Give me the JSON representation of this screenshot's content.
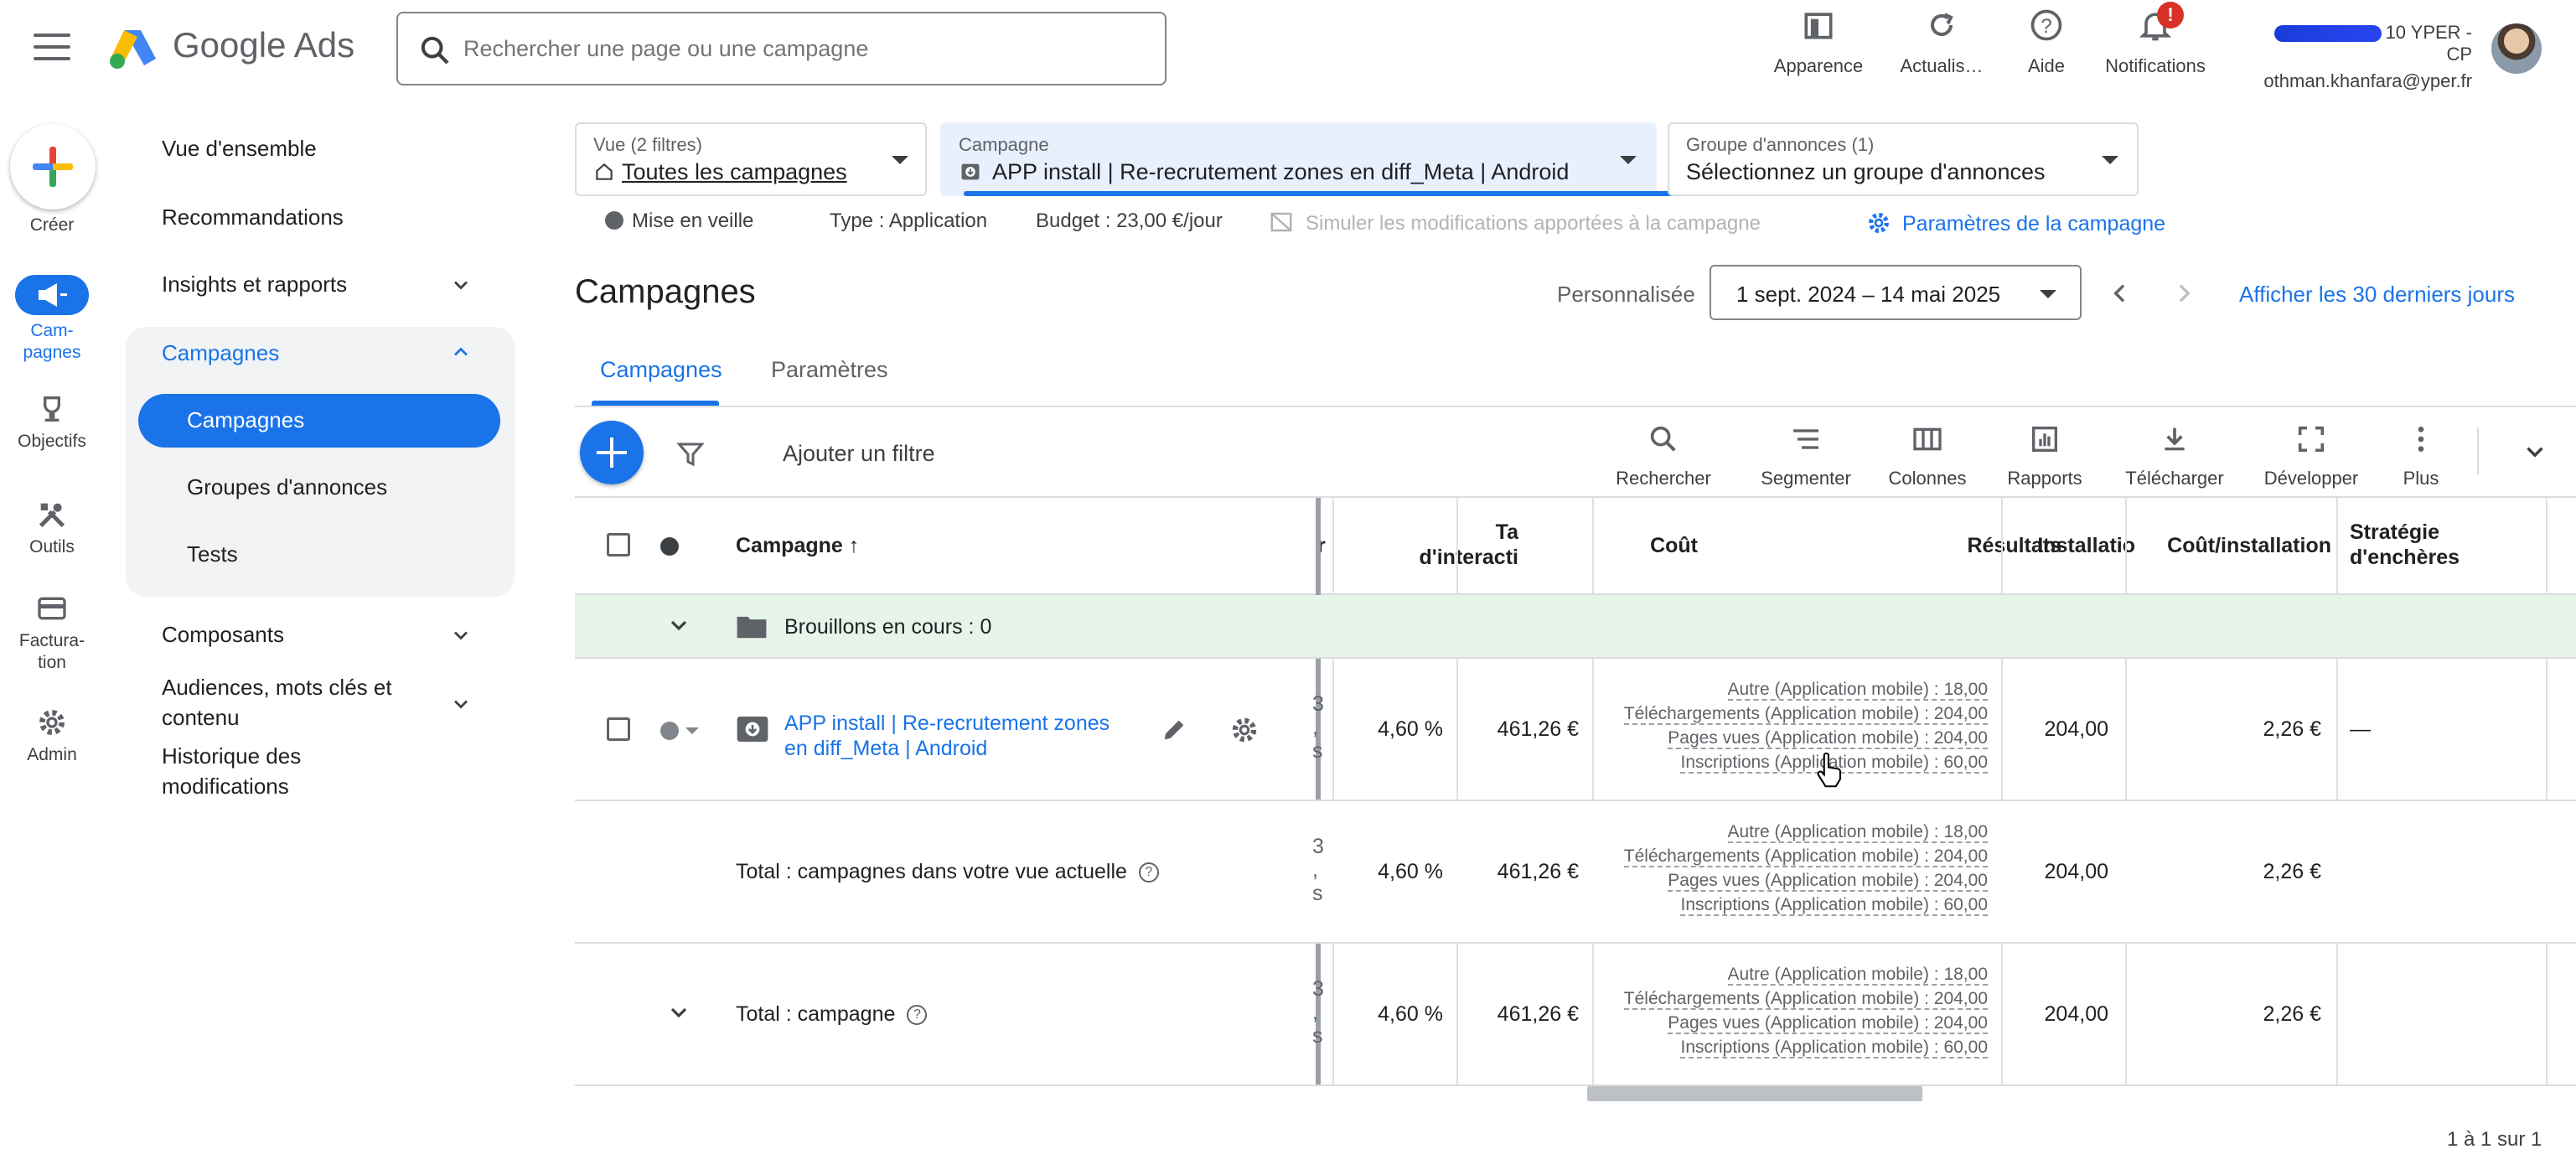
{
  "app": {
    "brand": "Google Ads"
  },
  "search": {
    "placeholder": "Rechercher une page ou une campagne"
  },
  "top_actions": {
    "appearance": "Apparence",
    "refresh": "Actualis…",
    "help": "Aide",
    "notifications": "Notifications",
    "notif_badge": "!"
  },
  "account": {
    "name": "10 YPER - CP",
    "email": "othman.khanfara@yper.fr"
  },
  "rail": {
    "create": "Créer",
    "campaigns": "Cam-\npagnes",
    "goals": "Objectifs",
    "tools": "Outils",
    "billing": "Factura-\ntion",
    "admin": "Admin"
  },
  "nav": {
    "overview": "Vue d'ensemble",
    "recommendations": "Recommandations",
    "insights": "Insights et rapports",
    "campaigns_group": "Campagnes",
    "campaigns": "Campagnes",
    "ad_groups": "Groupes d'annonces",
    "tests": "Tests",
    "assets": "Composants",
    "audiences": "Audiences, mots clés et contenu",
    "history": "Historique des modifications"
  },
  "filters": {
    "view_label": "Vue (2 filtres)",
    "view_value": "Toutes les campagnes",
    "campaign_label": "Campagne",
    "campaign_value": "APP install | Re-recrutement zones en diff_Meta | Android",
    "adgroup_label": "Groupe d'annonces (1)",
    "adgroup_value": "Sélectionnez un groupe d'annonces"
  },
  "campaign_info": {
    "status": "Mise en veille",
    "type": "Type : Application",
    "budget": "Budget : 23,00 €/jour",
    "simulate": "Simuler les modifications apportées à la campagne",
    "settings_link": "Paramètres de la campagne"
  },
  "heading": {
    "title": "Campagnes",
    "date_label": "Personnalisée",
    "date_range": "1 sept. 2024 – 14 mai 2025",
    "last30": "Afficher les 30 derniers jours"
  },
  "tabs": {
    "campaigns": "Campagnes",
    "settings": "Paramètres"
  },
  "toolbar": {
    "add_filter": "Ajouter un filtre",
    "search": "Rechercher",
    "segment": "Segmenter",
    "columns": "Colonnes",
    "reports": "Rapports",
    "download": "Télécharger",
    "expand": "Développer",
    "more": "Plus"
  },
  "table": {
    "headers": {
      "campaign": "Campagne",
      "clipped": "r",
      "interaction_rate": "Ta\nd'interacti",
      "cost": "Coût",
      "results": "Résultats",
      "installs": "Installatio",
      "cost_per_install": "Coût/installation",
      "bid_strategy": "Stratégie\nd'enchères"
    },
    "drafts": "Brouillons en cours : 0",
    "campaign_row": {
      "name": "APP install | Re-recrutement zones en diff_Meta | Android",
      "clipped": "3\n,\ns",
      "interaction_rate": "4,60 %",
      "cost": "461,26 €",
      "results": [
        "Autre (Application mobile) : 18,00",
        "Téléchargements (Application mobile) : 204,00",
        "Pages vues (Application mobile) : 204,00",
        "Inscriptions (Application mobile) : 60,00"
      ],
      "installs": "204,00",
      "cost_per_install": "2,26 €",
      "bid_strategy": "—"
    },
    "total_view": {
      "label": "Total : campagnes dans votre vue actuelle",
      "clipped": "3\n,\ns",
      "interaction_rate": "4,60 %",
      "cost": "461,26 €",
      "results": [
        "Autre (Application mobile) : 18,00",
        "Téléchargements (Application mobile) : 204,00",
        "Pages vues (Application mobile) : 204,00",
        "Inscriptions (Application mobile) : 60,00"
      ],
      "installs": "204,00",
      "cost_per_install": "2,26 €"
    },
    "total_campaign": {
      "label": "Total : campagne",
      "clipped": "3\n,\ns",
      "interaction_rate": "4,60 %",
      "cost": "461,26 €",
      "results": [
        "Autre (Application mobile) : 18,00",
        "Téléchargements (Application mobile) : 204,00",
        "Pages vues (Application mobile) : 204,00",
        "Inscriptions (Application mobile) : 60,00"
      ],
      "installs": "204,00",
      "cost_per_install": "2,26 €"
    },
    "pager": "1 à 1 sur 1"
  },
  "colors": {
    "accent": "#1a73e8",
    "draft_bg": "#e6f4ea",
    "badge": "#d93025"
  }
}
